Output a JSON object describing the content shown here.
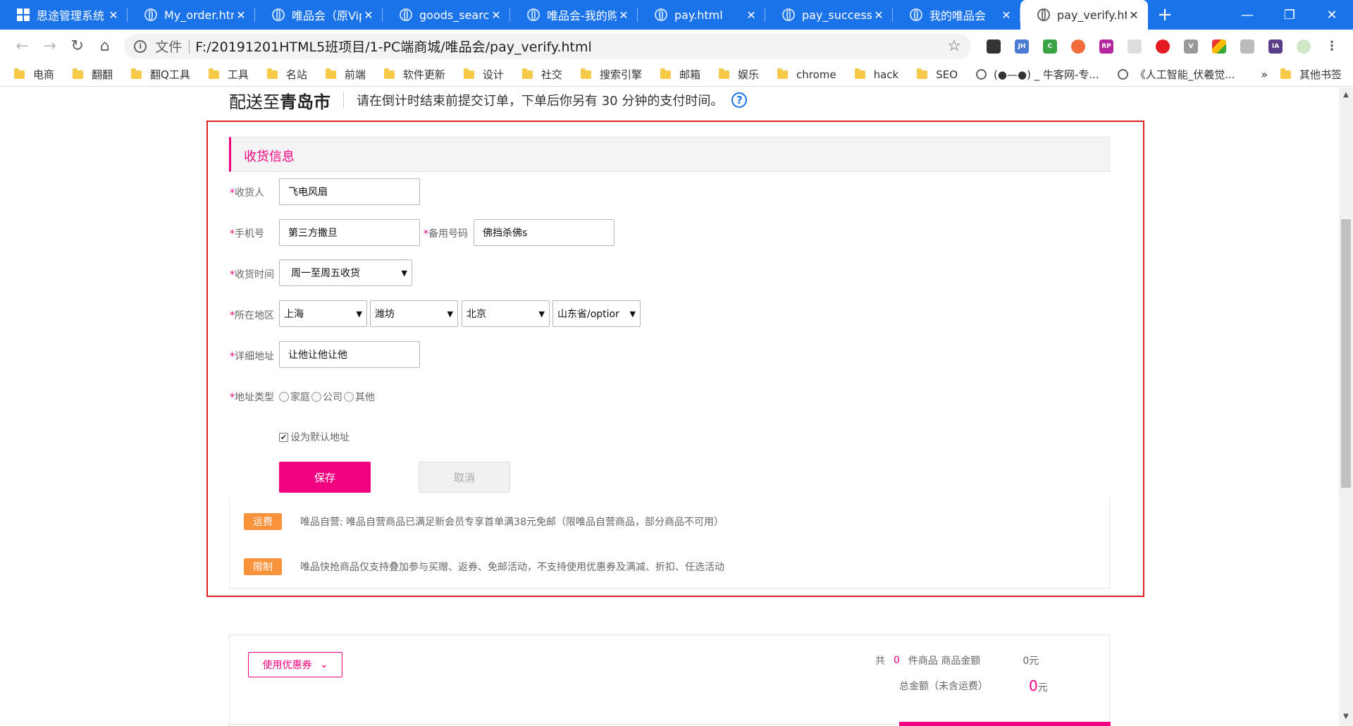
{
  "browser": {
    "tabs": [
      {
        "title": "思途管理系统",
        "icon": "windows-logo-icon",
        "active": false
      },
      {
        "title": "My_order.html",
        "icon": "globe-icon",
        "active": false
      },
      {
        "title": "唯品会（原Vip",
        "icon": "globe-icon",
        "active": false
      },
      {
        "title": "goods_search",
        "icon": "globe-icon",
        "active": false
      },
      {
        "title": "唯品会-我的购",
        "icon": "globe-icon",
        "active": false
      },
      {
        "title": "pay.html",
        "icon": "globe-icon",
        "active": false
      },
      {
        "title": "pay_success.h",
        "icon": "globe-icon",
        "active": false
      },
      {
        "title": "我的唯品会",
        "icon": "globe-icon",
        "active": false
      },
      {
        "title": "pay_verify.htm",
        "icon": "globe-icon",
        "active": true
      }
    ],
    "tab_close_glyph": "✕",
    "new_tab_glyph": "+",
    "window_controls": {
      "minimize": "—",
      "maximize": "❐",
      "close": "✕"
    },
    "address": {
      "scheme_label": "文件",
      "url": "F:/20191201HTML5班项目/1-PC端商城/唯品会/pay_verify.html"
    },
    "extensions": [
      "colorful-extension-icons"
    ],
    "bookmarks": [
      {
        "label": "电商",
        "type": "folder"
      },
      {
        "label": "翻翻",
        "type": "folder"
      },
      {
        "label": "翻Q工具",
        "type": "folder"
      },
      {
        "label": "工具",
        "type": "folder"
      },
      {
        "label": "名站",
        "type": "folder"
      },
      {
        "label": "前端",
        "type": "folder"
      },
      {
        "label": "软件更新",
        "type": "folder"
      },
      {
        "label": "设计",
        "type": "folder"
      },
      {
        "label": "社交",
        "type": "folder"
      },
      {
        "label": "搜索引擎",
        "type": "folder"
      },
      {
        "label": "邮箱",
        "type": "folder"
      },
      {
        "label": "娱乐",
        "type": "folder"
      },
      {
        "label": "chrome",
        "type": "folder"
      },
      {
        "label": "hack",
        "type": "folder"
      },
      {
        "label": "SEO",
        "type": "folder"
      },
      {
        "label": "(●—●) _ 牛客网-专...",
        "type": "page"
      },
      {
        "label": "《人工智能_伏羲觉...",
        "type": "page"
      }
    ],
    "bookmarks_more": "»",
    "other_bookmarks": "其他书签"
  },
  "page": {
    "delivery": {
      "prefix": "配送至",
      "city": "青岛市",
      "tip": "请在倒计时结束前提交订单，下单后你另有 30 分钟的支付时间。",
      "help_glyph": "?"
    },
    "section_title": "收货信息",
    "required_mark": "*",
    "form": {
      "receiver": {
        "label": "收货人",
        "value": "飞电风扇"
      },
      "phone": {
        "label": "手机号",
        "value": "第三方撒旦"
      },
      "backup_phone": {
        "label": "备用号码",
        "value": "佛挡杀佛s"
      },
      "delivery_time": {
        "label": "收货时间",
        "value": "周一至周五收货"
      },
      "region": {
        "label": "所在地区",
        "selects": [
          "上海",
          "潍坊",
          "北京",
          "山东省/optior"
        ]
      },
      "address_detail": {
        "label": "详细地址",
        "value": "让他让他让他"
      },
      "address_type": {
        "label": "地址类型",
        "options": [
          "家庭",
          "公司",
          "其他"
        ]
      },
      "default_address": {
        "label": "设为默认地址",
        "checked": true
      },
      "save_label": "保存",
      "cancel_label": "取消"
    },
    "notices": [
      {
        "badge": "运费",
        "text": "唯品自营: 唯品自营商品已满足新会员专享首单满38元免邮（限唯品自营商品，部分商品不可用）"
      },
      {
        "badge": "限制",
        "text": "唯品快抢商品仅支持叠加参与买赠、返券、免邮活动，不支持使用优惠券及满减、折扣、任选活动"
      }
    ],
    "summary": {
      "coupon_label": "使用优惠券",
      "count_prefix": "共",
      "count": "0",
      "count_suffix": "件商品 商品金额",
      "goods_amount": "0元",
      "total_label": "总金额（未含运费）",
      "total_value": "0",
      "total_unit": "元"
    }
  },
  "colors": {
    "brand_pink": "#f10180",
    "chrome_blue": "#1a73e8",
    "badge_orange": "#f8923b",
    "highlight_red": "#e02020"
  }
}
